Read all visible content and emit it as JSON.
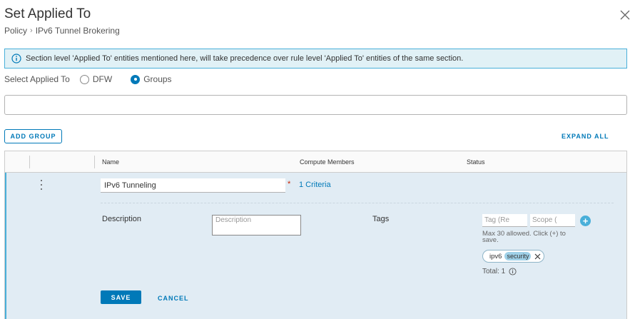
{
  "dialog": {
    "title": "Set Applied To",
    "breadcrumb": [
      "Policy",
      "IPv6 Tunnel Brokering"
    ]
  },
  "info_banner": {
    "text": "Section level 'Applied To' entities mentioned here, will take precedence over rule level 'Applied To' entities of the same section."
  },
  "applied_to": {
    "label": "Select Applied To",
    "options": [
      "DFW",
      "Groups"
    ],
    "selected": "Groups"
  },
  "search": {
    "value": ""
  },
  "toolbar": {
    "add_group_label": "ADD GROUP",
    "expand_all_label": "EXPAND ALL"
  },
  "grid": {
    "columns": [
      "Name",
      "Compute Members",
      "Status"
    ],
    "row": {
      "name_value": "IPv6 Tunneling",
      "required_mark": "*",
      "criteria_link": "1 Criteria",
      "description_label": "Description",
      "description_placeholder": "Description",
      "tags_label": "Tags",
      "tag_placeholder": "Tag (Re",
      "scope_placeholder": "Scope (",
      "tag_hint": "Max 30 allowed. Click (+) to save.",
      "tags": [
        {
          "tag": "ipv6",
          "scope": "security"
        }
      ],
      "total_label": "Total: 1",
      "save_label": "SAVE",
      "cancel_label": "CANCEL"
    }
  },
  "colors": {
    "accent": "#0079b8",
    "banner_bg": "#e1f1f6",
    "banner_border": "#49afd9",
    "expanded_row_bg": "#e1ecf4"
  }
}
